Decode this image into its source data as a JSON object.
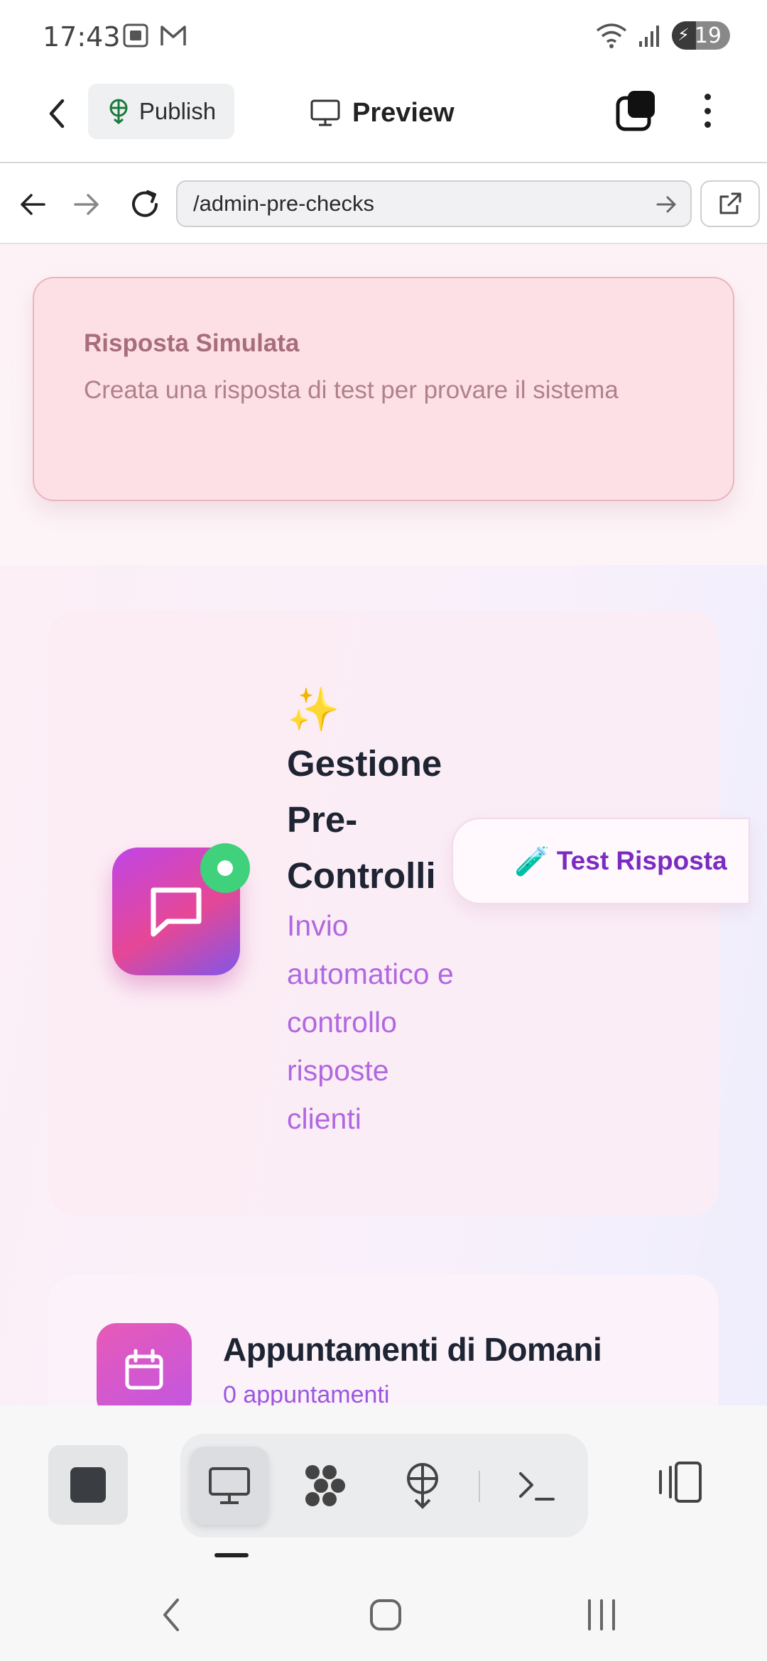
{
  "status_bar": {
    "time": "17:43",
    "battery": "19",
    "icons": [
      "screenshot-icon",
      "gmail-icon",
      "wifi-icon",
      "signal-icon",
      "battery-icon"
    ]
  },
  "header": {
    "publish_label": "Publish",
    "preview_label": "Preview"
  },
  "browser": {
    "url": "/admin-pre-checks"
  },
  "toast": {
    "title": "Risposta Simulata",
    "description": "Creata una risposta di test per provare il sistema"
  },
  "hero": {
    "sparkle": "✨",
    "title": "Gestione Pre-Controlli",
    "subtitle": "Invio automatico e controllo risposte clienti",
    "test_button_icon": "🧪",
    "test_button_label": "Test Risposta"
  },
  "appointments": {
    "title": "Appuntamenti di Domani",
    "count": "0 appuntamenti"
  },
  "colors": {
    "accent_purple": "#7b2bc0",
    "subtitle_purple": "#b068e0",
    "toast_bg": "#fde0e5",
    "online_green": "#3fd17c"
  }
}
